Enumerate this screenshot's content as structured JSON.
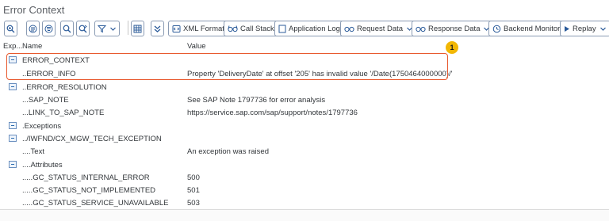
{
  "window": {
    "title": "Error Context"
  },
  "toolbar": {
    "xml_format": "XML Format",
    "call_stack": "Call Stack",
    "application_log": "Application Log",
    "request_data": "Request Data",
    "response_data": "Response Data",
    "backend_monitor": "Backend Monitor",
    "replay": "Replay"
  },
  "grid": {
    "columns": {
      "expander": "Exp...",
      "name": "Name",
      "value": "Value"
    },
    "rows": [
      {
        "name": "ERROR_CONTEXT",
        "value": "",
        "expander": true
      },
      {
        "name": "..ERROR_INFO",
        "value": "Property 'DeliveryDate' at offset '205' has invalid value '/Date(1750464000000)/'",
        "expander": false
      },
      {
        "name": "..ERROR_RESOLUTION",
        "value": "",
        "expander": true
      },
      {
        "name": "...SAP_NOTE",
        "value": "See SAP Note 1797736 for error analysis",
        "expander": false
      },
      {
        "name": "...LINK_TO_SAP_NOTE",
        "value": "https://service.sap.com/sap/support/notes/1797736",
        "expander": false
      },
      {
        "name": ".Exceptions",
        "value": "",
        "expander": true
      },
      {
        "name": "../IWFND/CX_MGW_TECH_EXCEPTION",
        "value": "",
        "expander": true
      },
      {
        "name": "....Text",
        "value": "An exception was raised",
        "expander": false
      },
      {
        "name": "....Attributes",
        "value": "",
        "expander": true
      },
      {
        "name": ".....GC_STATUS_INTERNAL_ERROR",
        "value": "500",
        "expander": false
      },
      {
        "name": ".....GC_STATUS_NOT_IMPLEMENTED",
        "value": "501",
        "expander": false
      },
      {
        "name": ".....GC_STATUS_SERVICE_UNAVAILABLE",
        "value": "503",
        "expander": false
      }
    ]
  },
  "annotation": {
    "badge_number": "1",
    "highlight_color": "#e8592e",
    "badge_color": "#f2b705"
  },
  "icons": [
    "zoom-in-icon",
    "details-icon",
    "collapse-icon",
    "search-icon",
    "search-next-icon",
    "filter-icon",
    "dropdown-icon",
    "table-icon",
    "expand-all-icon",
    "xml-icon",
    "glasses-icon",
    "document-icon",
    "monitor-icon",
    "play-icon"
  ]
}
